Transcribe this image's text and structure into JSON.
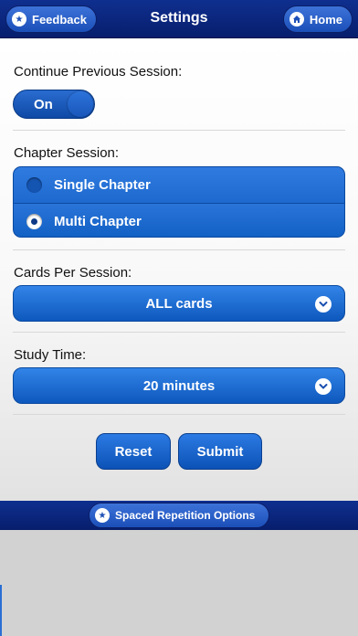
{
  "header": {
    "title": "Settings",
    "feedback_label": "Feedback",
    "home_label": "Home"
  },
  "settings": {
    "continue_previous": {
      "label": "Continue Previous Session:",
      "value": "On"
    },
    "chapter_session": {
      "label": "Chapter Session:",
      "options": [
        {
          "label": "Single Chapter",
          "selected": false
        },
        {
          "label": "Multi Chapter",
          "selected": true
        }
      ]
    },
    "cards_per_session": {
      "label": "Cards Per Session:",
      "value": "ALL cards"
    },
    "study_time": {
      "label": "Study Time:",
      "value": "20 minutes"
    }
  },
  "actions": {
    "reset_label": "Reset",
    "submit_label": "Submit"
  },
  "footer": {
    "spaced_repetition_label": "Spaced Repetition Options"
  },
  "colors": {
    "nav_dark": "#0b2580",
    "button_blue": "#1a63c8",
    "accent_light": "#3d73d9"
  },
  "icons": {
    "feedback": "star-icon",
    "home": "home-icon",
    "dropdown": "chevron-down-icon",
    "spaced": "star-icon"
  }
}
